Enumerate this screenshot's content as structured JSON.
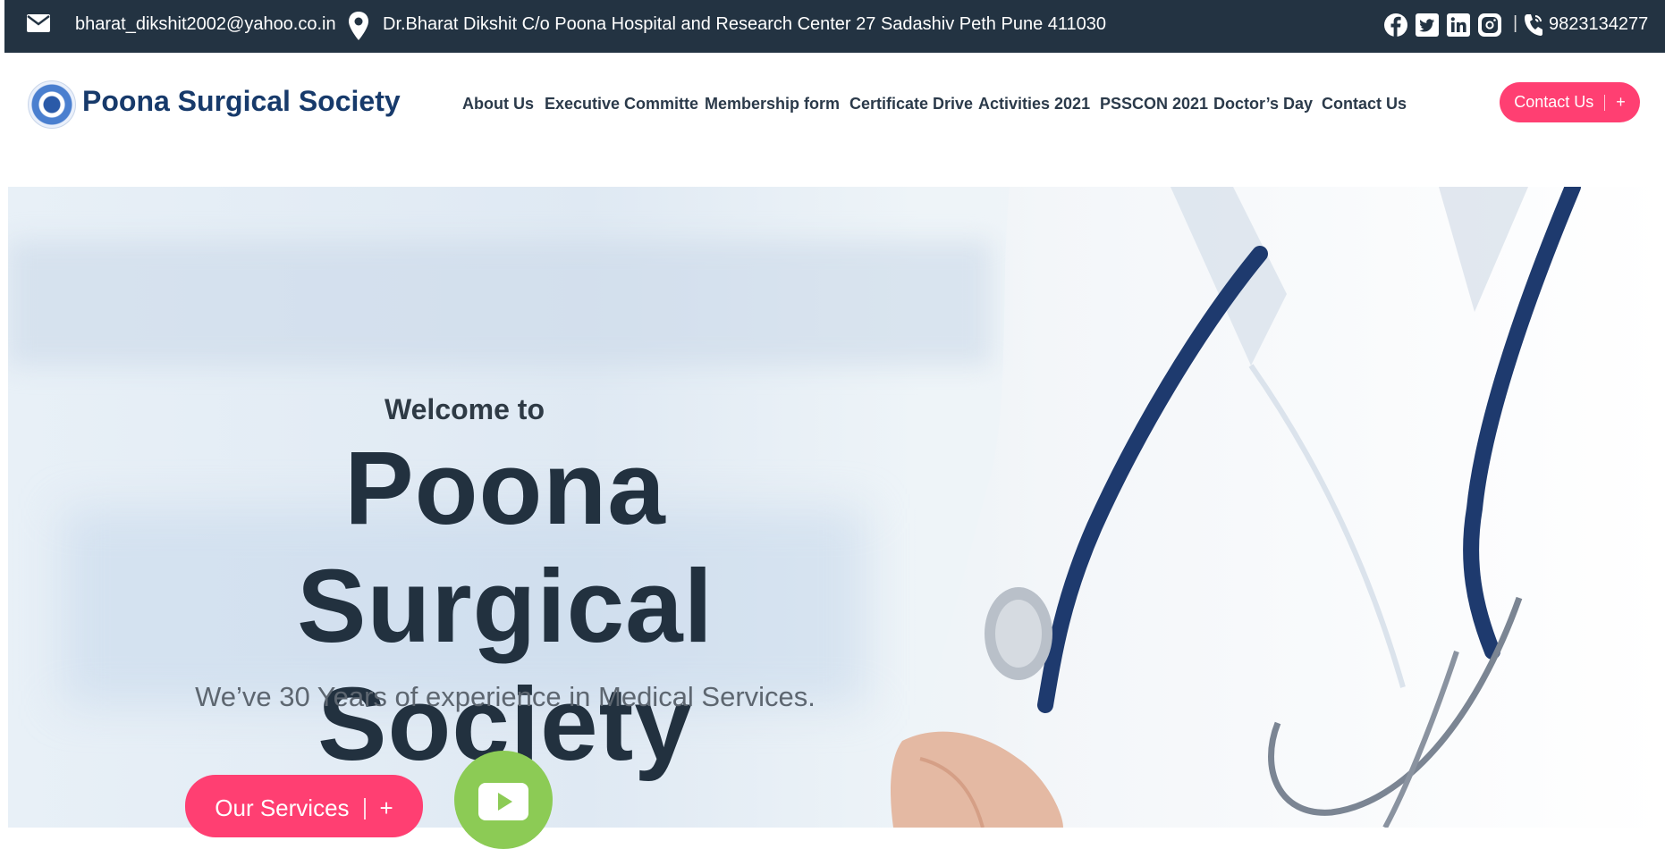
{
  "topbar": {
    "email": "bharat_dikshit2002@yahoo.co.in",
    "address": "Dr.Bharat Dikshit C/o Poona Hospital and Research Center 27 Sadashiv Peth Pune 411030",
    "separator": "|",
    "phone": "9823134277",
    "icons": [
      "mail-icon",
      "location-pin-icon",
      "facebook-icon",
      "twitter-icon",
      "linkedin-icon",
      "instagram-icon",
      "phone-icon"
    ]
  },
  "brand": {
    "name": "Poona Surgical Society"
  },
  "nav": {
    "items": [
      {
        "label": "About Us"
      },
      {
        "label": "Executive Committe"
      },
      {
        "label": "Membership form"
      },
      {
        "label": "Certificate Drive"
      },
      {
        "label": "Activities 2021"
      },
      {
        "label": "PSSCON 2021"
      },
      {
        "label": "Doctor’s Day"
      },
      {
        "label": "Contact Us"
      }
    ],
    "cta_label": "Contact Us",
    "cta_plus": "+"
  },
  "hero": {
    "welcome": "Welcome to",
    "headline": "Poona Surgical Society",
    "tagline": "We’ve 30 Years of experience in Medical Services.",
    "services_label": "Our Services",
    "services_plus": "+"
  },
  "colors": {
    "topbar_bg": "#233342",
    "accent": "#ff3f72",
    "brand": "#173a6b",
    "play_button": "#8ccb55"
  }
}
